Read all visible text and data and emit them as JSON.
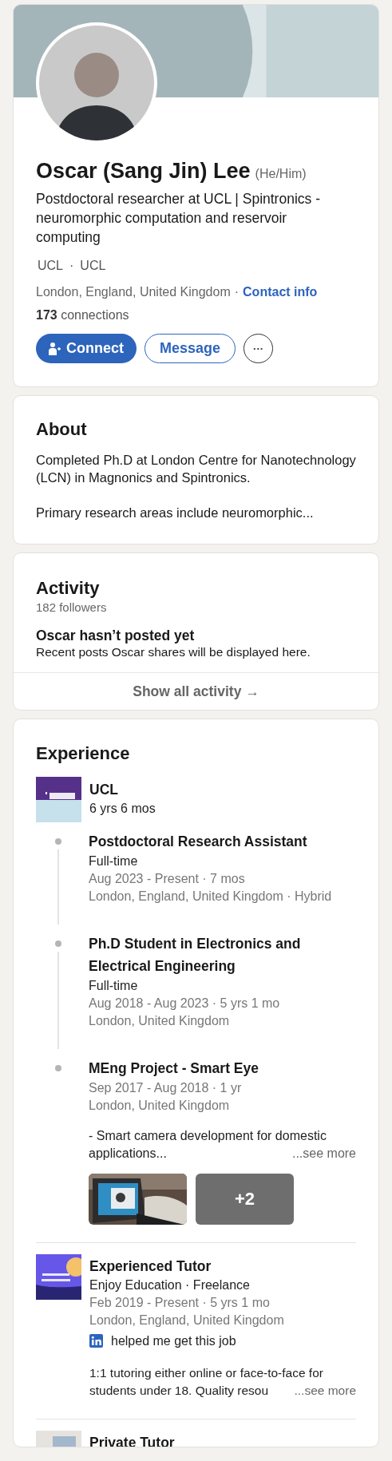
{
  "profile": {
    "name": "Oscar (Sang Jin) Lee",
    "pronouns": "(He/Him)",
    "headline": "Postdoctoral researcher at UCL | Spintronics - neuromorphic computation and reservoir computing",
    "orgs": [
      "UCL",
      "UCL"
    ],
    "orgs_separator": "·",
    "location": "London, England, United Kingdom",
    "location_separator": "·",
    "contact_link": "Contact info",
    "connections_count": "173",
    "connections_label": "connections",
    "buttons": [
      {
        "kind": "primary",
        "label": "Connect"
      },
      {
        "kind": "outline",
        "label": "Message"
      },
      {
        "kind": "more",
        "label": "···"
      }
    ]
  },
  "about": {
    "title": "About",
    "paragraphs": [
      "Completed Ph.D at London Centre for Nanotechnology (LCN) in Magnonics and Spintronics.",
      "Primary research areas include neuromorphic..."
    ]
  },
  "activity": {
    "title": "Activity",
    "followers": "182 followers",
    "empty_title": "Oscar hasn’t posted yet",
    "empty_text": "Recent posts Oscar shares will be displayed here.",
    "show_all": "Show all activity →"
  },
  "experience": {
    "title": "Experience",
    "companies": [
      {
        "kind": "ucl",
        "name": "UCL",
        "duration": "6 yrs 6 mos",
        "roles": [
          {
            "title": "Postdoctoral Research Assistant",
            "type": "Full-time",
            "dates": "Aug 2023 - Present · 7 mos",
            "location": "London, England, United Kingdom · Hybrid"
          },
          {
            "title": "Ph.D Student in Electronics and Electrical Engineering",
            "type": "Full-time",
            "dates": "Aug 2018 - Aug 2023 · 5 yrs 1 mo",
            "location": "London, United Kingdom"
          },
          {
            "title": "MEng Project - Smart Eye",
            "dates": "Sep 2017 - Aug 2018 · 1 yr",
            "location": "London, United Kingdom",
            "description": "- Smart camera development for domestic applications...",
            "see_more": "...see more",
            "media": [
              {
                "kind": "picture"
              },
              {
                "kind": "more",
                "count": "+2"
              }
            ]
          }
        ]
      },
      {
        "kind": "enjoy",
        "title": "Experienced Tutor",
        "subtitle": "Enjoy Education · Freelance",
        "dates": "Feb 2019 - Present · 5 yrs 1 mo",
        "location": "London, England, United Kingdom",
        "helped": "helped me get this job",
        "description": "1:1 tutoring either online or face-to-face for students under 18. Quality resou",
        "see_more": "...see more"
      },
      {
        "kind": "plain",
        "title": "Private Tutor"
      }
    ]
  }
}
